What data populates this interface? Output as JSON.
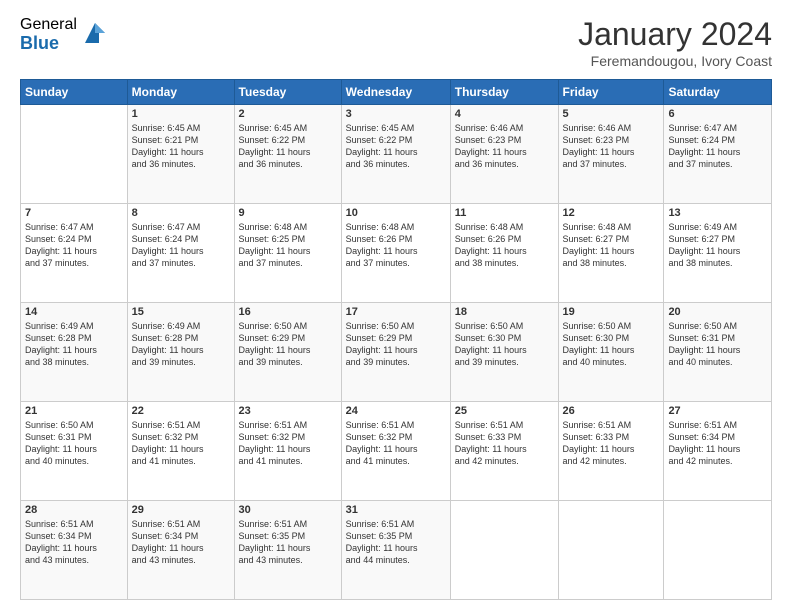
{
  "header": {
    "logo_general": "General",
    "logo_blue": "Blue",
    "month_title": "January 2024",
    "location": "Feremandougou, Ivory Coast"
  },
  "days_of_week": [
    "Sunday",
    "Monday",
    "Tuesday",
    "Wednesday",
    "Thursday",
    "Friday",
    "Saturday"
  ],
  "weeks": [
    [
      {
        "day": "",
        "info": ""
      },
      {
        "day": "1",
        "info": "Sunrise: 6:45 AM\nSunset: 6:21 PM\nDaylight: 11 hours\nand 36 minutes."
      },
      {
        "day": "2",
        "info": "Sunrise: 6:45 AM\nSunset: 6:22 PM\nDaylight: 11 hours\nand 36 minutes."
      },
      {
        "day": "3",
        "info": "Sunrise: 6:45 AM\nSunset: 6:22 PM\nDaylight: 11 hours\nand 36 minutes."
      },
      {
        "day": "4",
        "info": "Sunrise: 6:46 AM\nSunset: 6:23 PM\nDaylight: 11 hours\nand 36 minutes."
      },
      {
        "day": "5",
        "info": "Sunrise: 6:46 AM\nSunset: 6:23 PM\nDaylight: 11 hours\nand 37 minutes."
      },
      {
        "day": "6",
        "info": "Sunrise: 6:47 AM\nSunset: 6:24 PM\nDaylight: 11 hours\nand 37 minutes."
      }
    ],
    [
      {
        "day": "7",
        "info": "Sunrise: 6:47 AM\nSunset: 6:24 PM\nDaylight: 11 hours\nand 37 minutes."
      },
      {
        "day": "8",
        "info": "Sunrise: 6:47 AM\nSunset: 6:24 PM\nDaylight: 11 hours\nand 37 minutes."
      },
      {
        "day": "9",
        "info": "Sunrise: 6:48 AM\nSunset: 6:25 PM\nDaylight: 11 hours\nand 37 minutes."
      },
      {
        "day": "10",
        "info": "Sunrise: 6:48 AM\nSunset: 6:26 PM\nDaylight: 11 hours\nand 37 minutes."
      },
      {
        "day": "11",
        "info": "Sunrise: 6:48 AM\nSunset: 6:26 PM\nDaylight: 11 hours\nand 38 minutes."
      },
      {
        "day": "12",
        "info": "Sunrise: 6:48 AM\nSunset: 6:27 PM\nDaylight: 11 hours\nand 38 minutes."
      },
      {
        "day": "13",
        "info": "Sunrise: 6:49 AM\nSunset: 6:27 PM\nDaylight: 11 hours\nand 38 minutes."
      }
    ],
    [
      {
        "day": "14",
        "info": "Sunrise: 6:49 AM\nSunset: 6:28 PM\nDaylight: 11 hours\nand 38 minutes."
      },
      {
        "day": "15",
        "info": "Sunrise: 6:49 AM\nSunset: 6:28 PM\nDaylight: 11 hours\nand 39 minutes."
      },
      {
        "day": "16",
        "info": "Sunrise: 6:50 AM\nSunset: 6:29 PM\nDaylight: 11 hours\nand 39 minutes."
      },
      {
        "day": "17",
        "info": "Sunrise: 6:50 AM\nSunset: 6:29 PM\nDaylight: 11 hours\nand 39 minutes."
      },
      {
        "day": "18",
        "info": "Sunrise: 6:50 AM\nSunset: 6:30 PM\nDaylight: 11 hours\nand 39 minutes."
      },
      {
        "day": "19",
        "info": "Sunrise: 6:50 AM\nSunset: 6:30 PM\nDaylight: 11 hours\nand 40 minutes."
      },
      {
        "day": "20",
        "info": "Sunrise: 6:50 AM\nSunset: 6:31 PM\nDaylight: 11 hours\nand 40 minutes."
      }
    ],
    [
      {
        "day": "21",
        "info": "Sunrise: 6:50 AM\nSunset: 6:31 PM\nDaylight: 11 hours\nand 40 minutes."
      },
      {
        "day": "22",
        "info": "Sunrise: 6:51 AM\nSunset: 6:32 PM\nDaylight: 11 hours\nand 41 minutes."
      },
      {
        "day": "23",
        "info": "Sunrise: 6:51 AM\nSunset: 6:32 PM\nDaylight: 11 hours\nand 41 minutes."
      },
      {
        "day": "24",
        "info": "Sunrise: 6:51 AM\nSunset: 6:32 PM\nDaylight: 11 hours\nand 41 minutes."
      },
      {
        "day": "25",
        "info": "Sunrise: 6:51 AM\nSunset: 6:33 PM\nDaylight: 11 hours\nand 42 minutes."
      },
      {
        "day": "26",
        "info": "Sunrise: 6:51 AM\nSunset: 6:33 PM\nDaylight: 11 hours\nand 42 minutes."
      },
      {
        "day": "27",
        "info": "Sunrise: 6:51 AM\nSunset: 6:34 PM\nDaylight: 11 hours\nand 42 minutes."
      }
    ],
    [
      {
        "day": "28",
        "info": "Sunrise: 6:51 AM\nSunset: 6:34 PM\nDaylight: 11 hours\nand 43 minutes."
      },
      {
        "day": "29",
        "info": "Sunrise: 6:51 AM\nSunset: 6:34 PM\nDaylight: 11 hours\nand 43 minutes."
      },
      {
        "day": "30",
        "info": "Sunrise: 6:51 AM\nSunset: 6:35 PM\nDaylight: 11 hours\nand 43 minutes."
      },
      {
        "day": "31",
        "info": "Sunrise: 6:51 AM\nSunset: 6:35 PM\nDaylight: 11 hours\nand 44 minutes."
      },
      {
        "day": "",
        "info": ""
      },
      {
        "day": "",
        "info": ""
      },
      {
        "day": "",
        "info": ""
      }
    ]
  ]
}
